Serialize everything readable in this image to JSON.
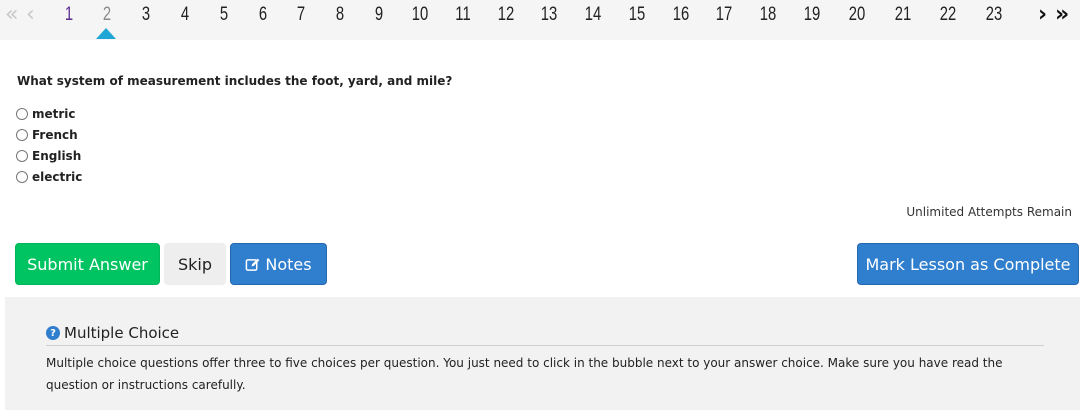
{
  "pager": {
    "prev_icon": "double-chevron-left",
    "next_icon": "double-chevron-right",
    "current": "2",
    "pages": [
      "1",
      "2",
      "3",
      "4",
      "5",
      "6",
      "7",
      "8",
      "9",
      "10",
      "11",
      "12",
      "13",
      "14",
      "15",
      "16",
      "17",
      "18",
      "19",
      "20",
      "21",
      "22",
      "23"
    ]
  },
  "question": {
    "text": "What system of measurement includes the foot, yard, and mile?",
    "choices": [
      "metric",
      "French",
      "English",
      "electric"
    ]
  },
  "attempts_text": "Unlimited Attempts Remain",
  "buttons": {
    "submit": "Submit Answer",
    "skip": "Skip",
    "notes": "Notes",
    "mark_complete": "Mark Lesson as Complete"
  },
  "info": {
    "title": "Multiple Choice",
    "body": "Multiple choice questions offer three to five choices per question. You just need to click in the bubble next to your answer choice. Make sure you have read the question or instructions carefully."
  },
  "colors": {
    "submit": "#00c462",
    "primary": "#2f7fce",
    "caret": "#1ea6d6",
    "visited_page": "#5b2c8e"
  }
}
